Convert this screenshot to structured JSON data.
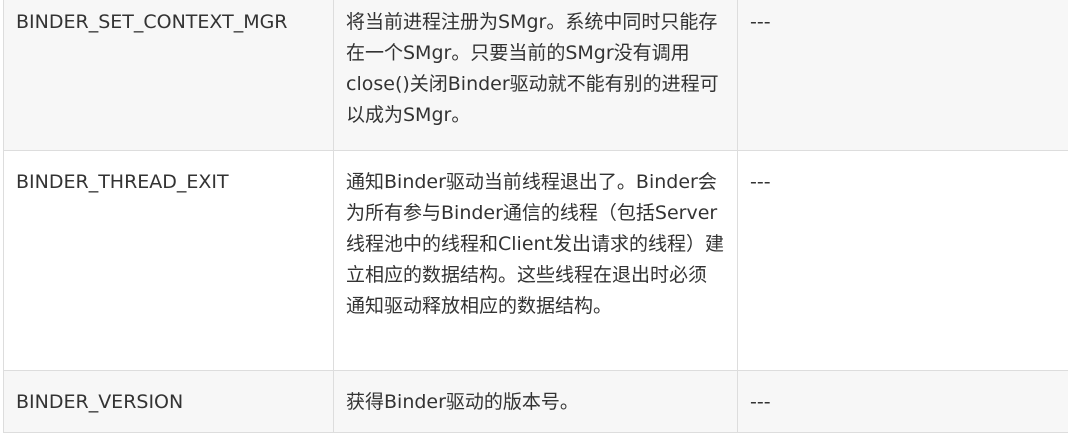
{
  "rows": [
    {
      "name": "BINDER_SET_CONTEXT_MGR",
      "description": "将当前进程注册为SMgr。系统中同时只能存在一个SMgr。只要当前的SMgr没有调用close()关闭Binder驱动就不能有别的进程可以成为SMgr。",
      "extra": "---"
    },
    {
      "name": "BINDER_THREAD_EXIT",
      "description": "通知Binder驱动当前线程退出了。Binder会为所有参与Binder通信的线程（包括Server线程池中的线程和Client发出请求的线程）建立相应的数据结构。这些线程在退出时必须通知驱动释放相应的数据结构。",
      "extra": "---"
    },
    {
      "name": "BINDER_VERSION",
      "description": "获得Binder驱动的版本号。",
      "extra": "---"
    }
  ]
}
